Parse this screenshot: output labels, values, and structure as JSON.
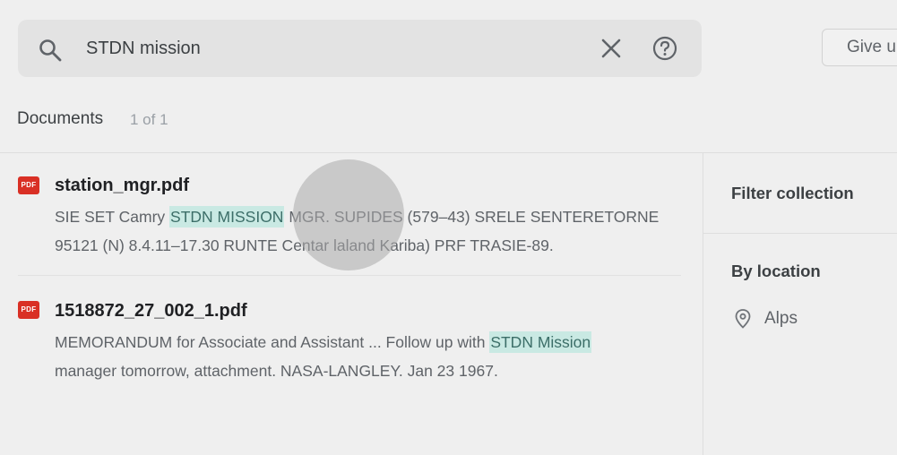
{
  "search": {
    "query": "STDN mission",
    "placeholder": ""
  },
  "header": {
    "give_button_label": "Give u"
  },
  "documents": {
    "title": "Documents",
    "count": "1 of 1"
  },
  "results": [
    {
      "icon_label": "PDF",
      "title": "station_mgr.pdf",
      "line1_before": "SIE SET Camry ",
      "line1_highlight": "STDN MISSION",
      "line1_after": " MGR. SUPIDES (579–43) SRELE SENTERETORNE",
      "line2": "95121 (N) 8.4.11–17.30 RUNTE Centar laland Kariba) PRF TRASIE-89."
    },
    {
      "icon_label": "PDF",
      "title": "1518872_27_002_1.pdf",
      "line1_before": "MEMORANDUM for Associate and Assistant ...  Follow up with ",
      "line1_highlight": "STDN Mission",
      "line1_after": "",
      "line2": "manager tomorrow, attachment. NASA-LANGLEY. Jan 23 1967."
    }
  ],
  "sidebar": {
    "filter_title": "Filter collection",
    "location_title": "By location",
    "locations": [
      {
        "label": "Alps",
        "icon": "location-pin-icon"
      }
    ]
  },
  "colors": {
    "background": "#efefef",
    "search_bg": "#e3e3e3",
    "pdf_red": "#d93025",
    "highlight_bg": "#c9e9e3"
  },
  "icons": {
    "search": "search-icon",
    "clear": "close-icon",
    "help": "help-icon"
  }
}
